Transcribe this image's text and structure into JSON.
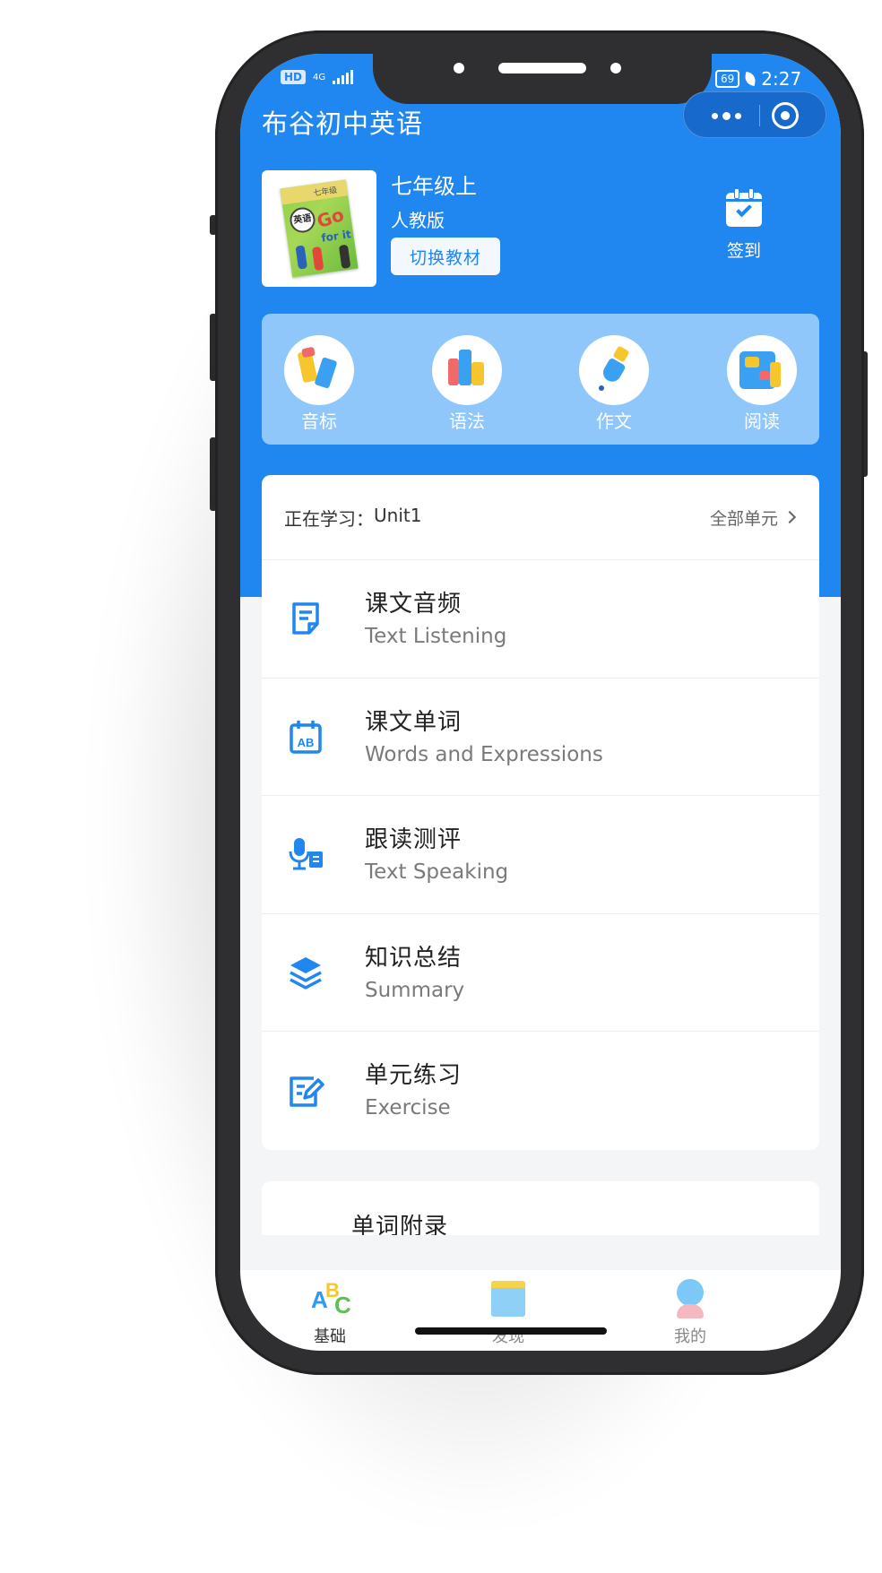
{
  "status_bar": {
    "network_badge": "HD",
    "network_type": "4G",
    "battery": "69",
    "time": "2:27"
  },
  "app": {
    "title": "布谷初中英语"
  },
  "capsule": {
    "more_icon": "more-dots-icon",
    "close_icon": "target-close-icon"
  },
  "textbook": {
    "grade": "七年级上",
    "edition": "人教版",
    "switch_label": "切换教材",
    "cover": {
      "badge": "英语",
      "grade_text": "七年级",
      "go": "Go",
      "for_it": "for it"
    }
  },
  "checkin": {
    "label": "签到",
    "icon": "calendar-check-icon"
  },
  "features": [
    {
      "label": "音标",
      "icon": "phonetics-icon"
    },
    {
      "label": "语法",
      "icon": "grammar-icon"
    },
    {
      "label": "作文",
      "icon": "writing-icon"
    },
    {
      "label": "阅读",
      "icon": "reading-icon"
    }
  ],
  "unit": {
    "current_prefix": "正在学习：",
    "current_unit": "Unit1",
    "all_units_label": "全部单元"
  },
  "lessons": [
    {
      "title": "课文音频",
      "subtitle": "Text Listening",
      "icon": "document-icon"
    },
    {
      "title": "课文单词",
      "subtitle": "Words and Expressions",
      "icon": "ab-calendar-icon"
    },
    {
      "title": "跟读测评",
      "subtitle": "Text Speaking",
      "icon": "microphone-icon"
    },
    {
      "title": "知识总结",
      "subtitle": "Summary",
      "icon": "layers-icon"
    },
    {
      "title": "单元练习",
      "subtitle": "Exercise",
      "icon": "edit-icon"
    }
  ],
  "next_section": {
    "title": "单词附录"
  },
  "tabs": [
    {
      "label": "基础",
      "icon": "abc-icon",
      "active": true
    },
    {
      "label": "发现",
      "icon": "book-icon",
      "active": false
    },
    {
      "label": "我的",
      "icon": "user-icon",
      "active": false
    }
  ],
  "colors": {
    "primary": "#1f87ef",
    "feature_panel": "#8fc7fb",
    "background": "#f4f5f7"
  }
}
